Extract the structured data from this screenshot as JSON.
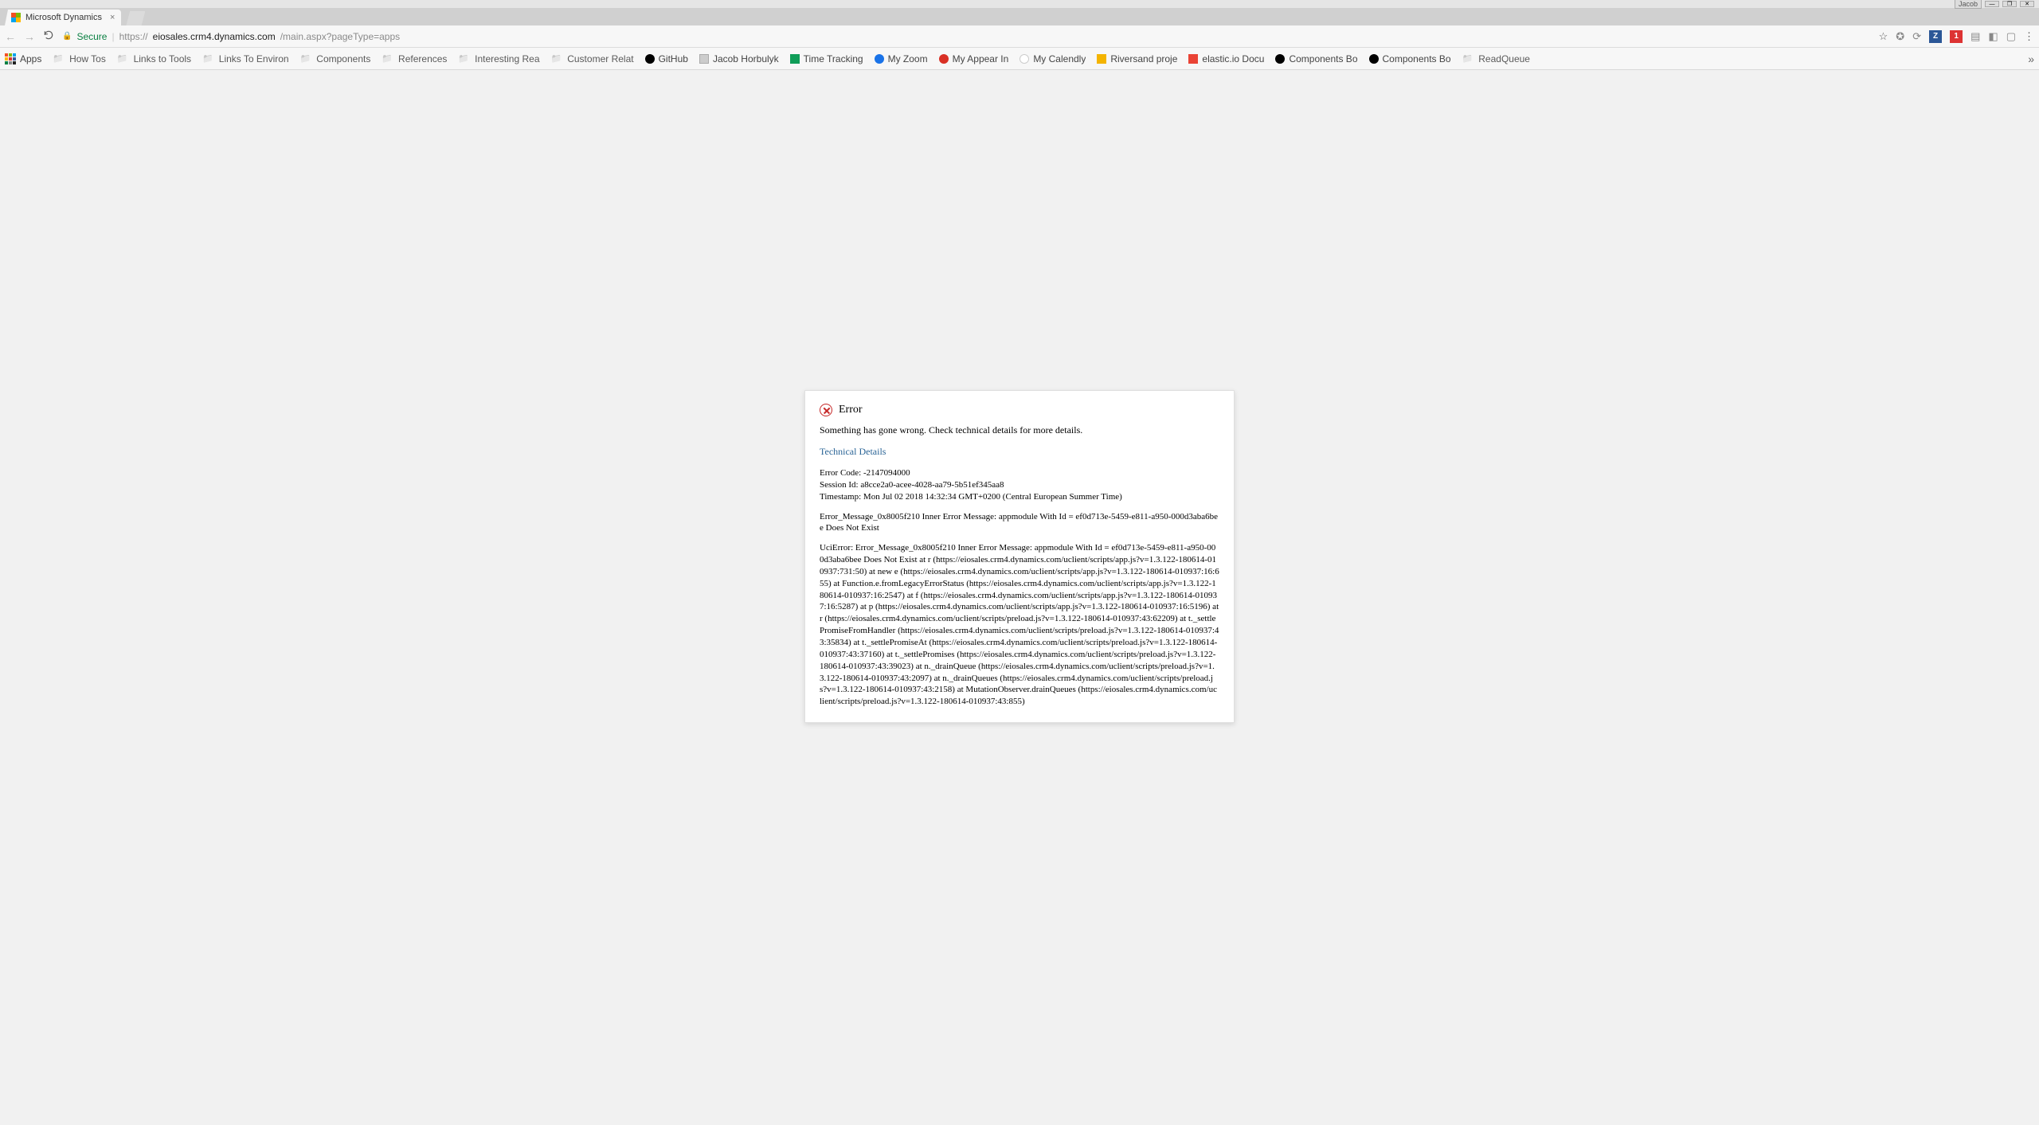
{
  "window": {
    "user": "Jacob"
  },
  "tab": {
    "title": "Microsoft Dynamics"
  },
  "address": {
    "secure": "Secure",
    "host": "eiosales.crm4.dynamics.com",
    "path": "/main.aspx?pageType=apps",
    "scheme": "https://"
  },
  "ext_icons": {
    "z": "Z",
    "one": "1"
  },
  "bookmarks": {
    "apps": "Apps",
    "howtos": "How Tos",
    "links_tools": "Links to Tools",
    "links_env": "Links To Environ",
    "components": "Components",
    "references": "References",
    "interesting": "Interesting Rea",
    "customer": "Customer Relat",
    "github": "GitHub",
    "jacob": "Jacob Horbulyk",
    "timetrack": "Time Tracking",
    "myzoom": "My Zoom",
    "myappear": "My Appear In",
    "mycalendly": "My Calendly",
    "riversand": "Riversand proje",
    "elastic": "elastic.io Docu",
    "comp_bo1": "Components Bo",
    "comp_bo2": "Components Bo",
    "readqueue": "ReadQueue"
  },
  "error": {
    "title": "Error",
    "message": "Something has gone wrong. Check technical details for more details.",
    "tech_link": "Technical Details",
    "code_label": "Error Code: -2147094000",
    "session": "Session Id: a8cce2a0-acee-4028-aa79-5b51ef345aa8",
    "timestamp": "Timestamp: Mon Jul 02 2018 14:32:34 GMT+0200 (Central European Summer Time)",
    "msg1": "Error_Message_0x8005f210 Inner Error Message: appmodule With Id = ef0d713e-5459-e811-a950-000d3aba6bee Does Not Exist",
    "trace": "UciError: Error_Message_0x8005f210 Inner Error Message: appmodule With Id = ef0d713e-5459-e811-a950-000d3aba6bee Does Not Exist at r (https://eiosales.crm4.dynamics.com/uclient/scripts/app.js?v=1.3.122-180614-010937:731:50) at new e (https://eiosales.crm4.dynamics.com/uclient/scripts/app.js?v=1.3.122-180614-010937:16:655) at Function.e.fromLegacyErrorStatus (https://eiosales.crm4.dynamics.com/uclient/scripts/app.js?v=1.3.122-180614-010937:16:2547) at f (https://eiosales.crm4.dynamics.com/uclient/scripts/app.js?v=1.3.122-180614-010937:16:5287) at p (https://eiosales.crm4.dynamics.com/uclient/scripts/app.js?v=1.3.122-180614-010937:16:5196) at r (https://eiosales.crm4.dynamics.com/uclient/scripts/preload.js?v=1.3.122-180614-010937:43:62209) at t._settlePromiseFromHandler (https://eiosales.crm4.dynamics.com/uclient/scripts/preload.js?v=1.3.122-180614-010937:43:35834) at t._settlePromiseAt (https://eiosales.crm4.dynamics.com/uclient/scripts/preload.js?v=1.3.122-180614-010937:43:37160) at t._settlePromises (https://eiosales.crm4.dynamics.com/uclient/scripts/preload.js?v=1.3.122-180614-010937:43:39023) at n._drainQueue (https://eiosales.crm4.dynamics.com/uclient/scripts/preload.js?v=1.3.122-180614-010937:43:2097) at n._drainQueues (https://eiosales.crm4.dynamics.com/uclient/scripts/preload.js?v=1.3.122-180614-010937:43:2158) at MutationObserver.drainQueues (https://eiosales.crm4.dynamics.com/uclient/scripts/preload.js?v=1.3.122-180614-010937:43:855)"
  }
}
